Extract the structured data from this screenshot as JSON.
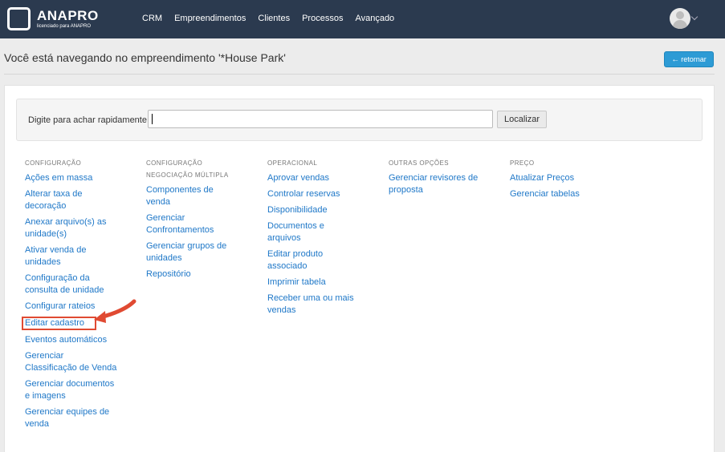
{
  "header": {
    "logo_name": "ANAPRO",
    "logo_sub": "licenciado para ANAPRO",
    "nav": [
      "CRM",
      "Empreendimentos",
      "Clientes",
      "Processos",
      "Avançado"
    ]
  },
  "page": {
    "title": "Você está navegando no empreendimento '*House Park'",
    "back_label": "retornar"
  },
  "search": {
    "label": "Digite para achar rapidamente:",
    "value": "",
    "button": "Localizar"
  },
  "columns": [
    {
      "heading": "CONFIGURAÇÃO",
      "links": [
        "Ações em massa",
        "Alterar taxa de decoração",
        "Anexar arquivo(s) as unidade(s)",
        "Ativar venda de unidades",
        "Configuração da consulta de unidade",
        "Configurar rateios",
        "Editar cadastro",
        "Eventos automáticos",
        "Gerenciar Classificação de Venda",
        "Gerenciar documentos e imagens",
        "Gerenciar equipes de venda"
      ]
    },
    {
      "heading": "CONFIGURAÇÃO NEGOCIAÇÃO MÚLTIPLA",
      "links": [
        "Componentes de venda",
        "Gerenciar Confrontamentos",
        "Gerenciar grupos de unidades",
        "Repositório"
      ]
    },
    {
      "heading": "OPERACIONAL",
      "links": [
        "Aprovar vendas",
        "Controlar reservas",
        "Disponibilidade",
        "Documentos e arquivos",
        "Editar produto associado",
        "Imprimir tabela",
        "Receber uma ou mais vendas"
      ]
    },
    {
      "heading": "OUTRAS OPÇÕES",
      "links": [
        "Gerenciar revisores de proposta"
      ]
    },
    {
      "heading": "PREÇO",
      "links": [
        "Atualizar Preços",
        "Gerenciar tabelas"
      ]
    }
  ],
  "colors": {
    "topbar": "#2b3a4f",
    "link": "#1f78c8",
    "accent": "#2d9bd5",
    "annotation": "#e04a32"
  },
  "icons": {
    "back": "arrow-left-icon",
    "user": "user-avatar-icon",
    "menu": "chevron-down-icon"
  }
}
